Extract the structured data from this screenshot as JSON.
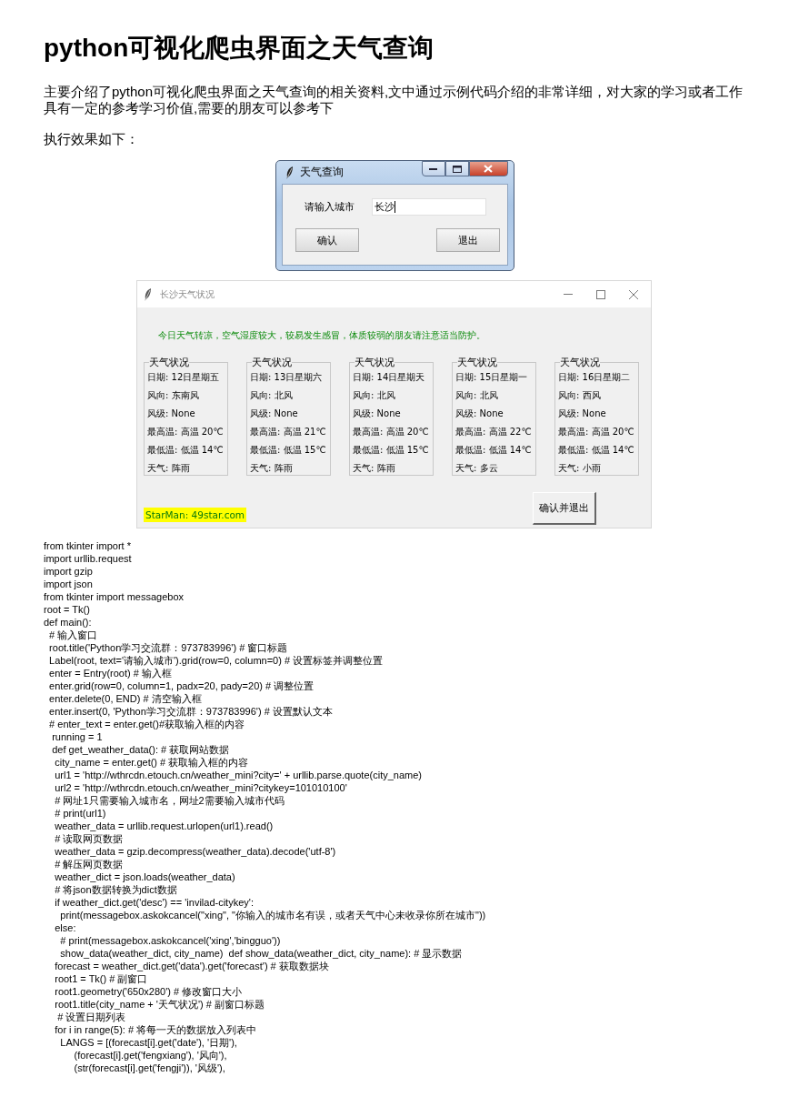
{
  "title": "python可视化爬虫界面之天气查询",
  "summary": "主要介绍了python可视化爬虫界面之天气查询的相关资料,文中通过示例代码介绍的非常详细，对大家的学习或者工作具有一定的参考学习价值,需要的朋友可以参考下",
  "intro": "执行效果如下：",
  "dialog": {
    "title": "天气查询",
    "label": "请输入城市",
    "value": "长沙",
    "buttons": [
      "确认",
      "退出"
    ]
  },
  "weather_window": {
    "title": "长沙天气状况",
    "notice": "今日天气转凉，空气湿度较大，较易发生感冒，体质较弱的朋友请注意适当防护。",
    "cards": [
      {
        "heading": "天气状况",
        "rows": [
          "日期: 12日星期五",
          "风向: 东南风",
          "风级: None",
          "最高温: 高温 20℃",
          "最低温: 低温 14℃",
          "天气: 阵雨"
        ]
      },
      {
        "heading": "天气状况",
        "rows": [
          "日期: 13日星期六",
          "风向: 北风",
          "风级: None",
          "最高温: 高温 21℃",
          "最低温: 低温 15℃",
          "天气: 阵雨"
        ]
      },
      {
        "heading": "天气状况",
        "rows": [
          "日期: 14日星期天",
          "风向: 北风",
          "风级: None",
          "最高温: 高温 20℃",
          "最低温: 低温 15℃",
          "天气: 阵雨"
        ]
      },
      {
        "heading": "天气状况",
        "rows": [
          "日期: 15日星期一",
          "风向: 北风",
          "风级: None",
          "最高温: 高温 22℃",
          "最低温: 低温 14℃",
          "天气: 多云"
        ]
      },
      {
        "heading": "天气状况",
        "rows": [
          "日期: 16日星期二",
          "风向: 西风",
          "风级: None",
          "最高温: 高温 20℃",
          "最低温: 低温 14℃",
          "天气: 小雨"
        ]
      }
    ],
    "button": "确认并退出",
    "footer_label": "StarMan: 49star.com"
  },
  "code_lines": [
    "from tkinter import *",
    "import urllib.request",
    "import gzip",
    "import json",
    "from tkinter import messagebox",
    "root = Tk()",
    "def main():",
    "  # 输入窗口",
    "  root.title('Python学习交流群：973783996') # 窗口标题",
    "  Label(root, text='请输入城市').grid(row=0, column=0) # 设置标签并调整位置",
    "  enter = Entry(root) # 输入框",
    "  enter.grid(row=0, column=1, padx=20, pady=20) # 调整位置",
    "  enter.delete(0, END) # 清空输入框",
    "  enter.insert(0, 'Python学习交流群：973783996') # 设置默认文本",
    "  # enter_text = enter.get()#获取输入框的内容",
    "   running = 1",
    "   def get_weather_data(): # 获取网站数据",
    "    city_name = enter.get() # 获取输入框的内容",
    "    url1 = 'http://wthrcdn.etouch.cn/weather_mini?city=' + urllib.parse.quote(city_name)",
    "    url2 = 'http://wthrcdn.etouch.cn/weather_mini?citykey=101010100'",
    "    # 网址1只需要输入城市名，网址2需要输入城市代码",
    "    # print(url1)",
    "    weather_data = urllib.request.urlopen(url1).read()",
    "    # 读取网页数据",
    "    weather_data = gzip.decompress(weather_data).decode('utf-8')",
    "    # 解压网页数据",
    "    weather_dict = json.loads(weather_data)",
    "    # 将json数据转换为dict数据",
    "    if weather_dict.get('desc') == 'invilad-citykey':",
    "      print(messagebox.askokcancel(\"xing\", \"你输入的城市名有误，或者天气中心未收录你所在城市\"))",
    "    else:",
    "      # print(messagebox.askokcancel('xing','bingguo'))",
    "      show_data(weather_dict, city_name)  def show_data(weather_dict, city_name): # 显示数据",
    "    forecast = weather_dict.get('data').get('forecast') # 获取数据块",
    "    root1 = Tk() # 副窗口",
    "    root1.geometry('650x280') # 修改窗口大小",
    "    root1.title(city_name + '天气状况') # 副窗口标题",
    "     # 设置日期列表",
    "    for i in range(5): # 将每一天的数据放入列表中",
    "      LANGS = [(forecast[i].get('date'), '日期'),",
    "           (forecast[i].get('fengxiang'), '风向'),",
    "           (str(forecast[i].get('fengji')), '风级'),"
  ]
}
